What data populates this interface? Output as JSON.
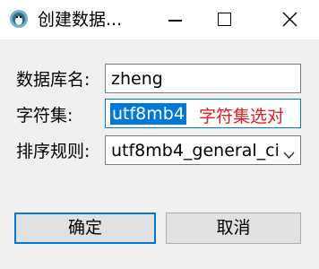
{
  "window": {
    "title": "创建数据..."
  },
  "form": {
    "db_name_label": "数据库名:",
    "db_name_value": "zheng",
    "charset_label": "字符集:",
    "charset_value": "utf8mb4",
    "collation_label": "排序规则:",
    "collation_value": "utf8mb4_general_ci"
  },
  "annotation": {
    "text": "字符集选对",
    "color": "#e02020"
  },
  "buttons": {
    "ok_label": "确定",
    "cancel_label": "取消"
  },
  "icons": {
    "app": "app-logo-icon",
    "minimize": "minimize-icon",
    "maximize": "maximize-icon",
    "close": "close-icon",
    "dropdown": "chevron-down-icon"
  },
  "colors": {
    "accent": "#0078d7",
    "annotation": "#e02020"
  }
}
